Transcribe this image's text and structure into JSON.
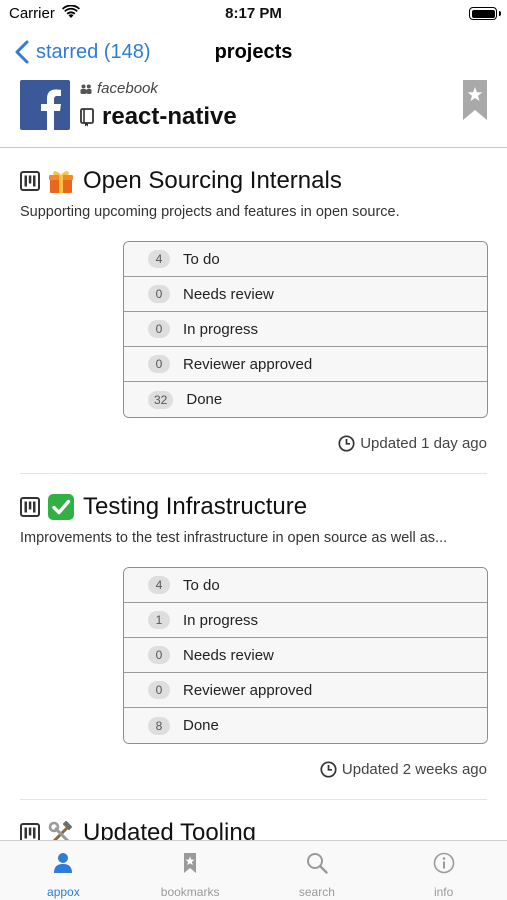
{
  "status_bar": {
    "carrier": "Carrier",
    "time": "8:17 PM"
  },
  "nav": {
    "back_label": "starred (148)",
    "title": "projects"
  },
  "repo": {
    "owner": "facebook",
    "name": "react-native"
  },
  "projects": [
    {
      "title": "Open Sourcing Internals",
      "emoji_icon": "gift-icon",
      "description": "Supporting upcoming projects and features in open source.",
      "columns": [
        {
          "count": "4",
          "label": "To do"
        },
        {
          "count": "0",
          "label": "Needs review"
        },
        {
          "count": "0",
          "label": "In progress"
        },
        {
          "count": "0",
          "label": "Reviewer approved"
        },
        {
          "count": "32",
          "label": "Done"
        }
      ],
      "updated": "Updated 1 day ago"
    },
    {
      "title": "Testing Infrastructure",
      "emoji_icon": "check-mark-icon",
      "description": "Improvements to the test infrastructure in open source as well as...",
      "columns": [
        {
          "count": "4",
          "label": "To do"
        },
        {
          "count": "1",
          "label": "In progress"
        },
        {
          "count": "0",
          "label": "Needs review"
        },
        {
          "count": "0",
          "label": "Reviewer approved"
        },
        {
          "count": "8",
          "label": "Done"
        }
      ],
      "updated": "Updated 2 weeks ago"
    },
    {
      "title": "Updated Tooling",
      "emoji_icon": "hammer-wrench-icon"
    }
  ],
  "tabs": [
    {
      "label": "appox",
      "icon": "person-icon",
      "active": true
    },
    {
      "label": "bookmarks",
      "icon": "bookmark-icon",
      "active": false
    },
    {
      "label": "search",
      "icon": "search-icon",
      "active": false
    },
    {
      "label": "info",
      "icon": "info-icon",
      "active": false
    }
  ],
  "colors": {
    "accent": "#2f7bd6",
    "facebook_blue": "#3b5998",
    "inactive_tab": "#9a9a9a"
  }
}
